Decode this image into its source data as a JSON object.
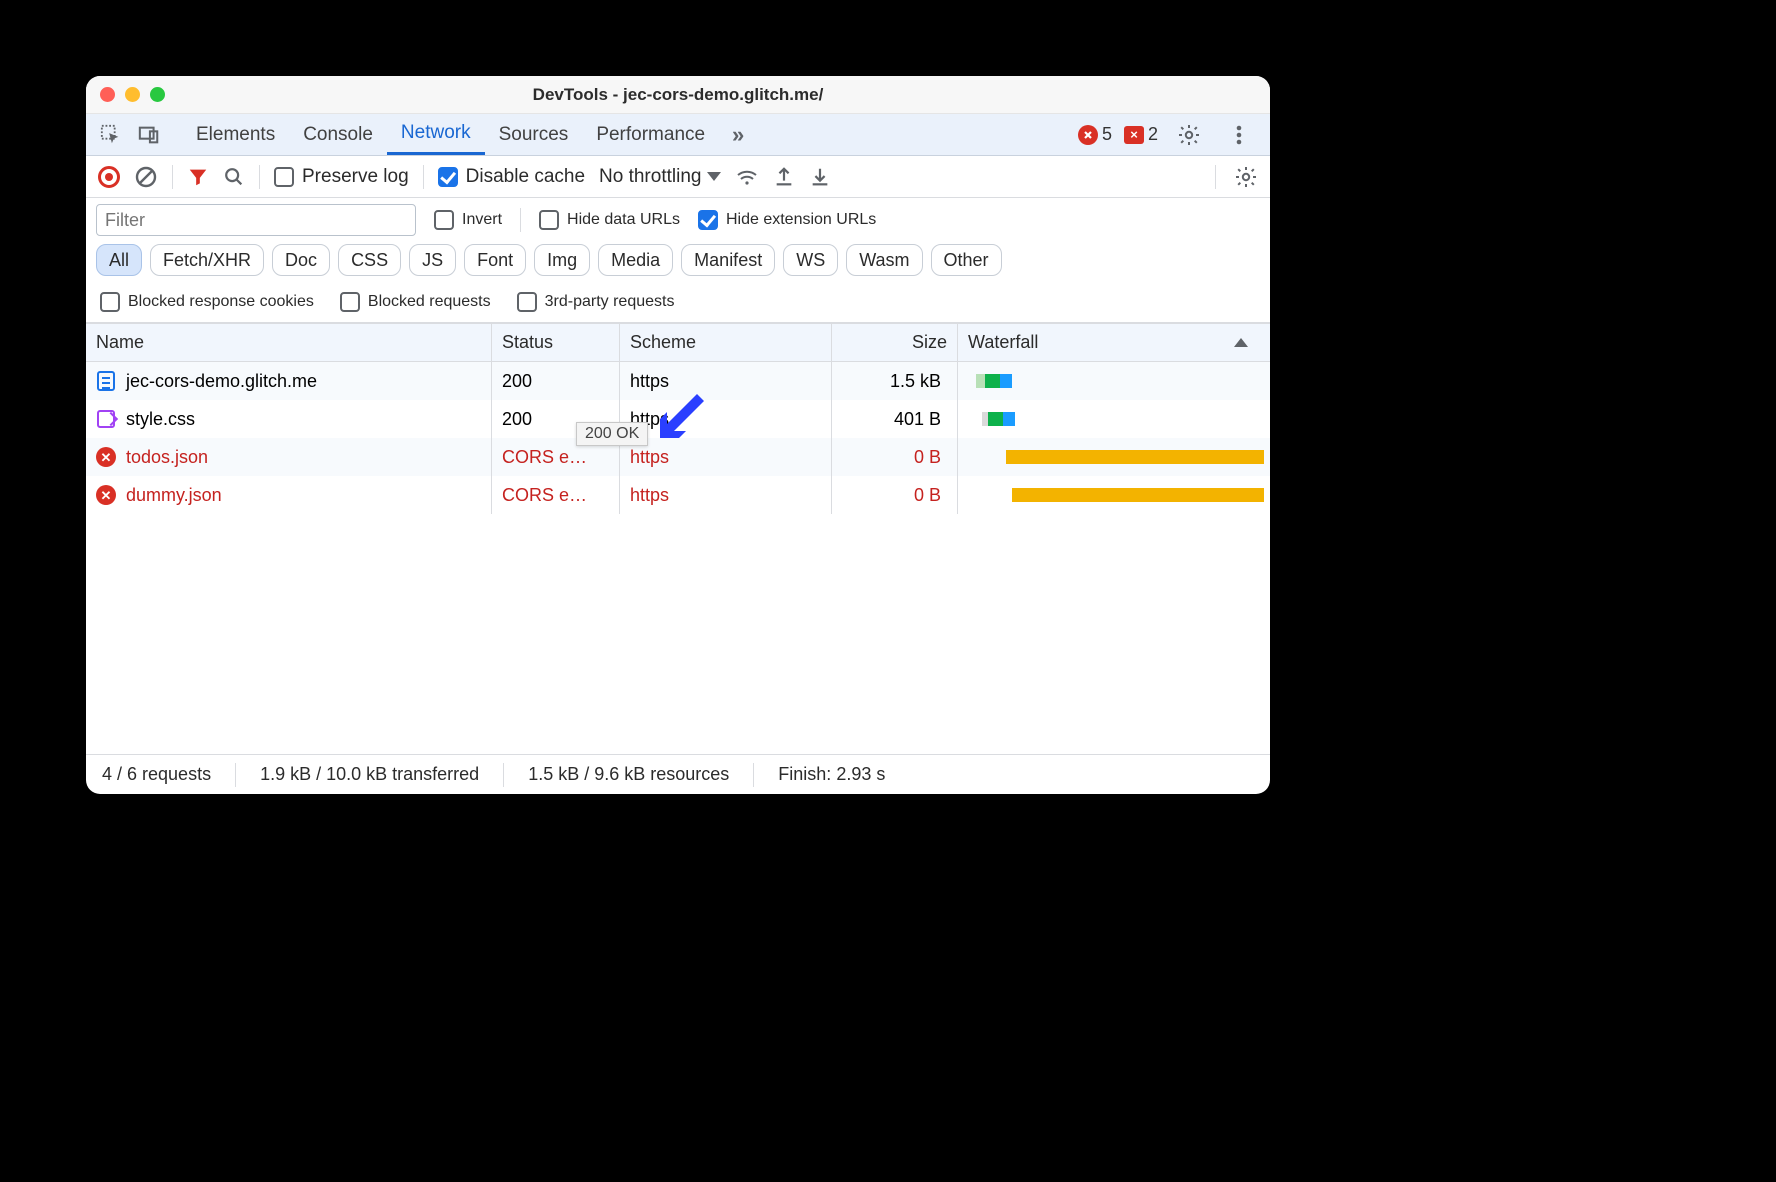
{
  "window": {
    "title": "DevTools - jec-cors-demo.glitch.me/"
  },
  "tabs": {
    "items": [
      "Elements",
      "Console",
      "Network",
      "Sources",
      "Performance"
    ],
    "activeIndex": 2,
    "errorCount": "5",
    "issueCount": "2"
  },
  "toolbar": {
    "preserveLog": {
      "label": "Preserve log",
      "checked": false
    },
    "disableCache": {
      "label": "Disable cache",
      "checked": true
    },
    "throttling": {
      "label": "No throttling"
    }
  },
  "filter": {
    "placeholder": "Filter",
    "invert": {
      "label": "Invert",
      "checked": false
    },
    "hideDataUrls": {
      "label": "Hide data URLs",
      "checked": false
    },
    "hideExtUrls": {
      "label": "Hide extension URLs",
      "checked": true
    },
    "types": [
      "All",
      "Fetch/XHR",
      "Doc",
      "CSS",
      "JS",
      "Font",
      "Img",
      "Media",
      "Manifest",
      "WS",
      "Wasm",
      "Other"
    ],
    "activeType": "All",
    "blockedCookies": {
      "label": "Blocked response cookies",
      "checked": false
    },
    "blockedReq": {
      "label": "Blocked requests",
      "checked": false
    },
    "thirdParty": {
      "label": "3rd-party requests",
      "checked": false
    }
  },
  "columns": {
    "name": "Name",
    "status": "Status",
    "scheme": "Scheme",
    "size": "Size",
    "waterfall": "Waterfall"
  },
  "rows": [
    {
      "icon": "doc",
      "name": "jec-cors-demo.glitch.me",
      "status": "200",
      "scheme": "https",
      "size": "1.5 kB",
      "error": false,
      "bars": [
        {
          "l": 4,
          "w": 3,
          "c": "#b8e0b7"
        },
        {
          "l": 7,
          "w": 5,
          "c": "#0db14b"
        },
        {
          "l": 12,
          "w": 4,
          "c": "#1a9cff"
        }
      ]
    },
    {
      "icon": "css",
      "name": "style.css",
      "status": "200",
      "scheme": "https",
      "size": "401 B",
      "error": false,
      "bars": [
        {
          "l": 6,
          "w": 2,
          "c": "#dadada"
        },
        {
          "l": 8,
          "w": 5,
          "c": "#0db14b"
        },
        {
          "l": 13,
          "w": 4,
          "c": "#1a9cff"
        }
      ]
    },
    {
      "icon": "err",
      "name": "todos.json",
      "status": "CORS e…",
      "scheme": "https",
      "size": "0 B",
      "error": true,
      "bars": [
        {
          "l": 14,
          "w": 86,
          "c": "#f3b300"
        }
      ]
    },
    {
      "icon": "err",
      "name": "dummy.json",
      "status": "CORS e…",
      "scheme": "https",
      "size": "0 B",
      "error": true,
      "bars": [
        {
          "l": 16,
          "w": 84,
          "c": "#f3b300"
        }
      ]
    }
  ],
  "tooltip": {
    "text": "200 OK"
  },
  "footer": {
    "requests": "4 / 6 requests",
    "transferred": "1.9 kB / 10.0 kB transferred",
    "resources": "1.5 kB / 9.6 kB resources",
    "finish": "Finish: 2.93 s"
  }
}
